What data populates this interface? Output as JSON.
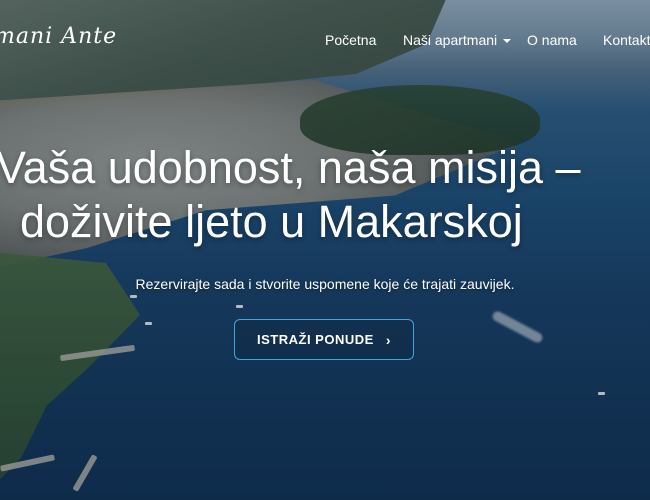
{
  "brand": {
    "logo_text": "mani Ante"
  },
  "nav": {
    "items": [
      {
        "label": "Početna"
      },
      {
        "label": "Naši apartmani",
        "has_dropdown": true
      },
      {
        "label": "O nama"
      },
      {
        "label": "Kontakt"
      }
    ]
  },
  "hero": {
    "headline_line1": "Vaša udobnost, naša misija –",
    "headline_line2": "doživite ljeto u Makarskoj",
    "subtitle": "Rezervirajte sada i stvorite uspomene koje će trajati zauvijek.",
    "cta_label": "ISTRAŽI PONUDE",
    "cta_icon": "chevron-right-icon"
  },
  "colors": {
    "cta_border": "#3fa6d8",
    "text": "#ffffff",
    "sea": "#1f4f7a"
  }
}
